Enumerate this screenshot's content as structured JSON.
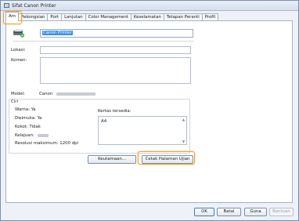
{
  "window": {
    "title": "Sifat Canon Printer"
  },
  "tabs": [
    {
      "label": "Am"
    },
    {
      "label": "Pekongsian"
    },
    {
      "label": "Port"
    },
    {
      "label": "Lanjutan"
    },
    {
      "label": "Color Management"
    },
    {
      "label": "Keselamatan"
    },
    {
      "label": "Tetapan Peranti"
    },
    {
      "label": "Profil"
    }
  ],
  "general": {
    "printer_name_value": "Canon Printer",
    "location_label": "Lokasi:",
    "location_value": "",
    "comment_label": "Komen:",
    "comment_value": "",
    "model_label": "Model:",
    "model_value": "Canon"
  },
  "features": {
    "group_title": "Ciri",
    "color_label": "Warna: Ya",
    "duplex_label": "Dwimuka: Ya",
    "staple_label": "Kokot: Tidak",
    "speed_label": "Kelajuan:",
    "resolution_label": "Resolusi maksimum: 1200 dpi",
    "paper_label": "Kertas tersedia:",
    "paper_items": [
      "A4"
    ]
  },
  "buttons": {
    "preferences": "Keutamaan...",
    "print_test": "Cetak Halaman Ujian",
    "ok": "OK",
    "cancel": "Batal",
    "apply": "Guna",
    "help": "Bantuan"
  },
  "colors": {
    "highlight_ring": "#f0a030",
    "selection": "#3d8ee8"
  }
}
